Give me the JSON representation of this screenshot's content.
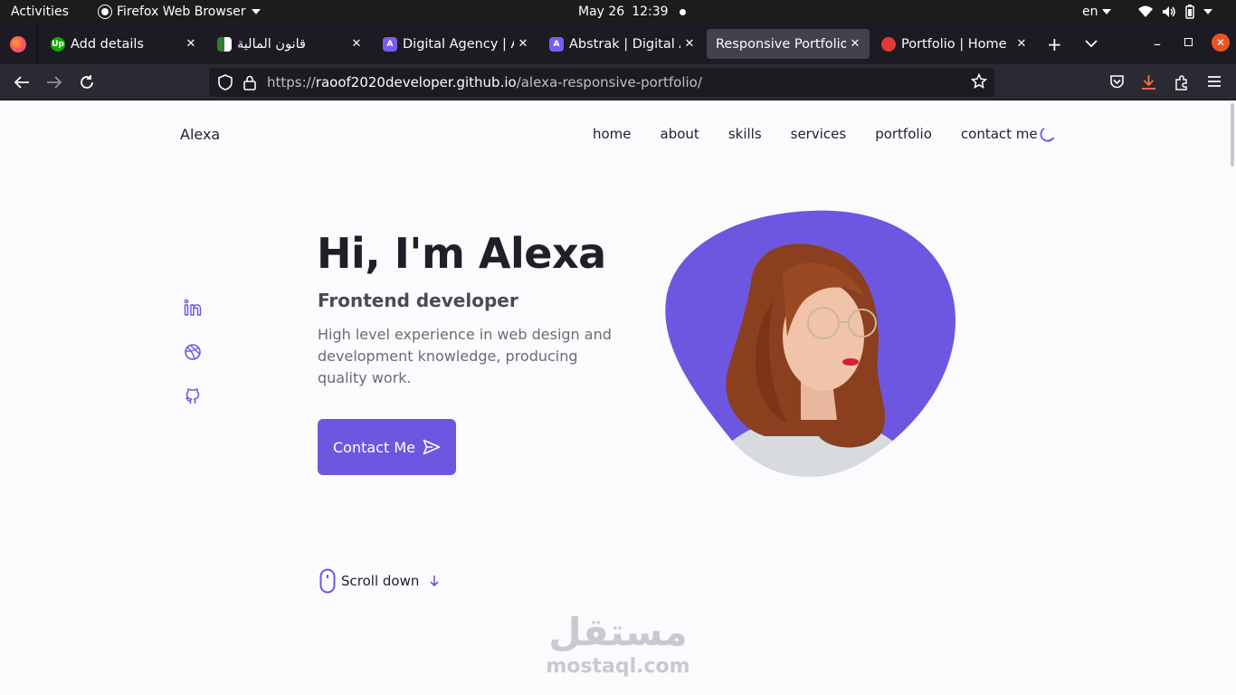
{
  "system_bar": {
    "activities": "Activities",
    "app_name": "Firefox Web Browser",
    "date": "May 26",
    "time": "12:39",
    "language": "en"
  },
  "tabs": [
    {
      "title": "Add details",
      "favicon_color": "#14a800",
      "favicon_text": "Up"
    },
    {
      "title": "قانون المالية",
      "favicon_color": "#2e7d32",
      "favicon_text": ""
    },
    {
      "title": "Digital Agency | Ab",
      "favicon_color": "#7b5cf0",
      "favicon_text": "A"
    },
    {
      "title": "Abstrak | Digital Ag",
      "favicon_color": "#7b5cf0",
      "favicon_text": "A"
    },
    {
      "title": "Responsive Portfolio W",
      "favicon_color": "",
      "favicon_text": ""
    },
    {
      "title": "Portfolio | Home",
      "favicon_color": "#e53935",
      "favicon_text": ""
    }
  ],
  "url": {
    "scheme": "https://",
    "host": "raoof2020developer.github.io",
    "path": "/alexa-responsive-portfolio/"
  },
  "page": {
    "logo": "Alexa",
    "nav": [
      "home",
      "about",
      "skills",
      "services",
      "portfolio",
      "contact me"
    ],
    "hero": {
      "title": "Hi, I'm Alexa",
      "subtitle": "Frontend developer",
      "description": "High level experience in web design and development knowledge, producing quality work.",
      "button_label": "Contact Me"
    },
    "scroll_label": "Scroll down",
    "accent_color": "#6e57e0"
  },
  "watermark": {
    "arabic": "مستقل",
    "latin": "mostaql.com"
  },
  "icons": [
    "linkedin-icon",
    "dribbble-icon",
    "github-icon",
    "moon-icon",
    "send-icon",
    "mouse-icon",
    "arrow-down-icon"
  ]
}
